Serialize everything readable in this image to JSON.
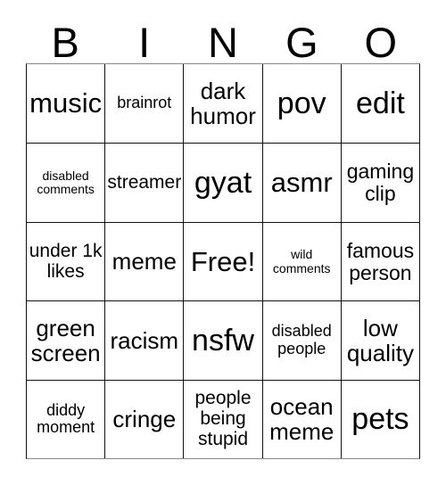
{
  "header": {
    "letters": [
      "B",
      "I",
      "N",
      "G",
      "O"
    ]
  },
  "grid": {
    "rows": [
      [
        {
          "text": "music",
          "size": "fs-xl"
        },
        {
          "text": "brainrot",
          "size": "fs-s"
        },
        {
          "text": "dark humor",
          "size": "fs-l"
        },
        {
          "text": "pov",
          "size": "fs-xxl"
        },
        {
          "text": "edit",
          "size": "fs-xxl"
        }
      ],
      [
        {
          "text": "disabled comments",
          "size": "fs-xs"
        },
        {
          "text": "streamer",
          "size": "fs-m"
        },
        {
          "text": "gyat",
          "size": "fs-xxl"
        },
        {
          "text": "asmr",
          "size": "fs-xl"
        },
        {
          "text": "gaming clip",
          "size": "fs-ml"
        }
      ],
      [
        {
          "text": "under 1k likes",
          "size": "fs-m"
        },
        {
          "text": "meme",
          "size": "fs-l"
        },
        {
          "text": "Free!",
          "size": "fs-xl"
        },
        {
          "text": "wild comments",
          "size": "fs-xs"
        },
        {
          "text": "famous person",
          "size": "fs-ml"
        }
      ],
      [
        {
          "text": "green screen",
          "size": "fs-l"
        },
        {
          "text": "racism",
          "size": "fs-l"
        },
        {
          "text": "nsfw",
          "size": "fs-xxl"
        },
        {
          "text": "disabled people",
          "size": "fs-s"
        },
        {
          "text": "low quality",
          "size": "fs-l"
        }
      ],
      [
        {
          "text": "diddy moment",
          "size": "fs-s"
        },
        {
          "text": "cringe",
          "size": "fs-l"
        },
        {
          "text": "people being stupid",
          "size": "fs-m"
        },
        {
          "text": "ocean meme",
          "size": "fs-l"
        },
        {
          "text": "pets",
          "size": "fs-xxl"
        }
      ]
    ]
  },
  "colors": {
    "background": "#ffffff",
    "text": "#000000",
    "border": "#111111",
    "border_outer": "#8a8a8a"
  }
}
